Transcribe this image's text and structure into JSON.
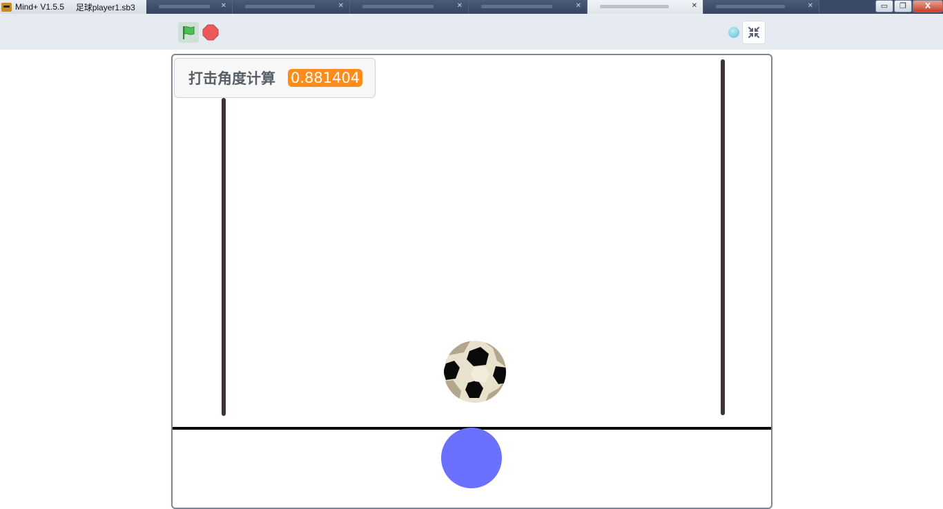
{
  "window": {
    "app_title": "Mind+ V1.5.5",
    "file_name": "足球player1.sb3",
    "controls": {
      "minimize": "▭",
      "restore": "❐",
      "close": "X"
    }
  },
  "toolbar": {
    "flag_icon": "green-flag-icon",
    "stop_icon": "stop-icon",
    "fullscreen_icon": "exit-fullscreen-icon"
  },
  "stage": {
    "monitor": {
      "label": "打击角度计算",
      "value": "0.881404"
    },
    "sprites": [
      "soccer-ball",
      "blue-player",
      "left-goal-post",
      "right-goal-post",
      "ground-line"
    ]
  },
  "colors": {
    "monitor_value_bg": "#ff8c1a",
    "player": "#6b70ff",
    "post": "#3f3434",
    "toolbar_bg": "#e6ebf1"
  }
}
